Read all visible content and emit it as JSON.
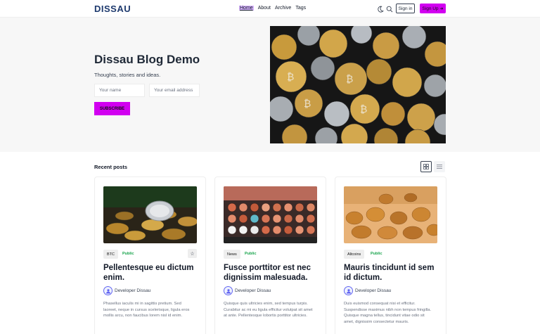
{
  "header": {
    "logo": "DISSAU",
    "nav": [
      "Home",
      "About",
      "Archive",
      "Tags"
    ],
    "signin_label": "Sign in",
    "signup_label": "Sign Up",
    "accent_color": "#d100f0"
  },
  "hero": {
    "title": "Dissau Blog Demo",
    "subtitle": "Thoughts, stories and ideas.",
    "name_placeholder": "Your name",
    "email_placeholder": "Your email address",
    "subscribe_label": "SUBSCRIBE"
  },
  "recent": {
    "title": "Recent posts",
    "posts": [
      {
        "tag": "BTC",
        "visibility": "Public",
        "title": "Pellentesque eu dictum enim.",
        "author": "Developer Dissau",
        "excerpt": "Phasellus iaculis mi in sagittis pretium. Sed laoreet, neque in cursus scelerisque, ligula eros mollis arcu, non faucibus lorem nisl id enim."
      },
      {
        "tag": "News",
        "visibility": "Public",
        "title": "Fusce porttitor est nec dignissim malesuada.",
        "author": "Developer Dissau",
        "excerpt": "Quisque quis ultricies enim, sed tempus turpis. Curabitur ac mi eu ligula efficitur volutpat sit amet at ante. Pellentesque lobortis porttitor ultricies."
      },
      {
        "tag": "Altcoins",
        "visibility": "Public",
        "title": "Mauris tincidunt id sem id dictum.",
        "author": "Developer Dissau",
        "excerpt": "Duis euismod consequat nisi et efficitur. Suspendisse maximus nibh non tempus fringilla. Quisque magna tellus, tincidunt vitae odio sit amet, dignissim consectetur mauris."
      }
    ]
  }
}
